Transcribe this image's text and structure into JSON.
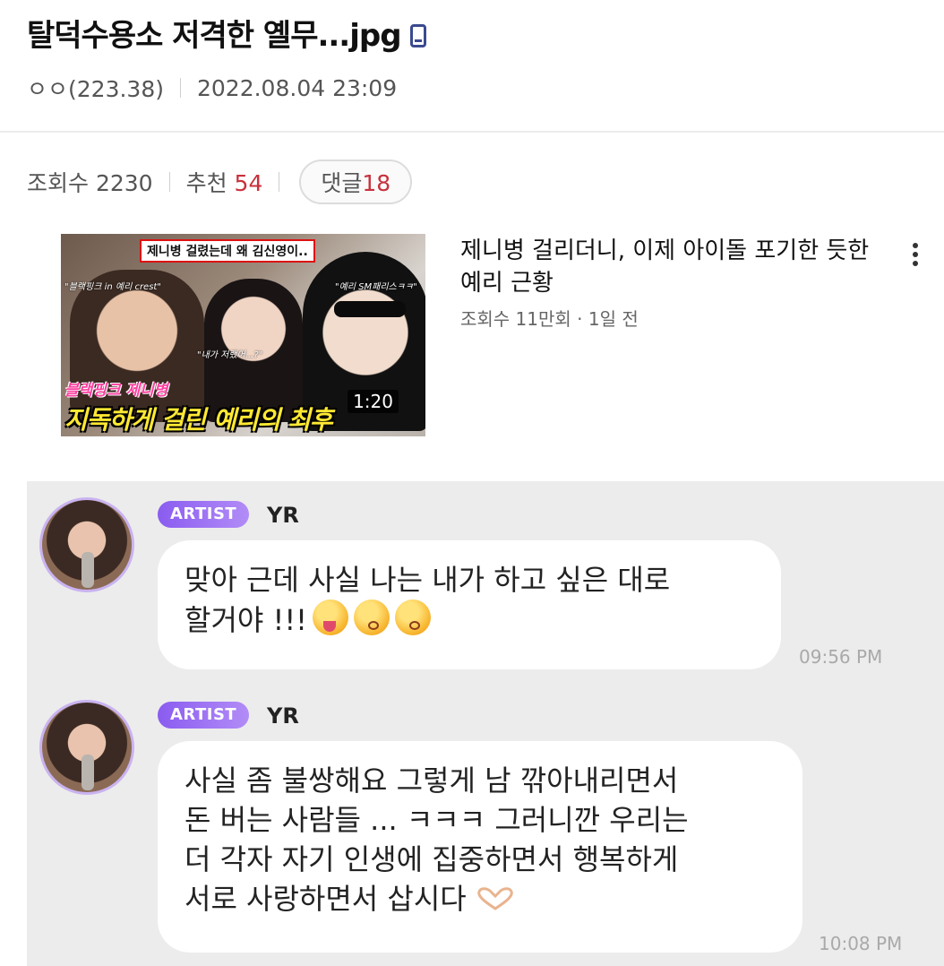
{
  "post": {
    "title": "탈덕수용소 저격한 옐무...jpg",
    "author": "ㅇㅇ(223.38)",
    "date": "2022.08.04 23:09",
    "views_label": "조회수 2230",
    "likes_label": "추천",
    "likes_value": "54",
    "comments_label": "댓글",
    "comments_value": "18"
  },
  "video": {
    "title": "제니병 걸리더니, 이제 아이돌 포기한 듯한 예리 근황",
    "meta": "조회수 11만회 · 1일 전",
    "duration": "1:20",
    "thumb_top_tag": "제니병 걸렸는데 왜 김신영이..",
    "thumb_tag_left": "\"블랙핑크 in 예리 crest\"",
    "thumb_tag_mid": "\"내가 저랬어...?\"",
    "thumb_tag_right": "\"예리 SM패리스ㅋㅋ\"",
    "thumb_pink_line": "블랙핑크 제니병",
    "thumb_yellow_line": "지독하게 걸린 예리의 최후"
  },
  "chat": {
    "messages": [
      {
        "badge": "ARTIST",
        "name": "YR",
        "line1": "맞아 근데 사실 나는 내가 하고 싶은 대로",
        "line2": "할거야 !!!",
        "time": "09:56 PM"
      },
      {
        "badge": "ARTIST",
        "name": "YR",
        "line1": "사실 좀 불쌍해요 그렇게 남 깎아내리면서",
        "line2": "돈 버는 사람들 ... ㅋㅋㅋ 그러니깐 우리는",
        "line3": "더 각자 자기 인생에 집중하면서 행복하게",
        "line4": "서로 사랑하면서 삽시다",
        "time": "10:08 PM"
      }
    ]
  },
  "colors": {
    "accent_red": "#c8313d",
    "artist_badge": "#8a5cf0",
    "chat_bg": "#ececec"
  },
  "icons": [
    "mobile-phone-icon",
    "more-vertical-icon",
    "tongue-emoji",
    "kiss-emoji",
    "heart-hands-emoji"
  ]
}
